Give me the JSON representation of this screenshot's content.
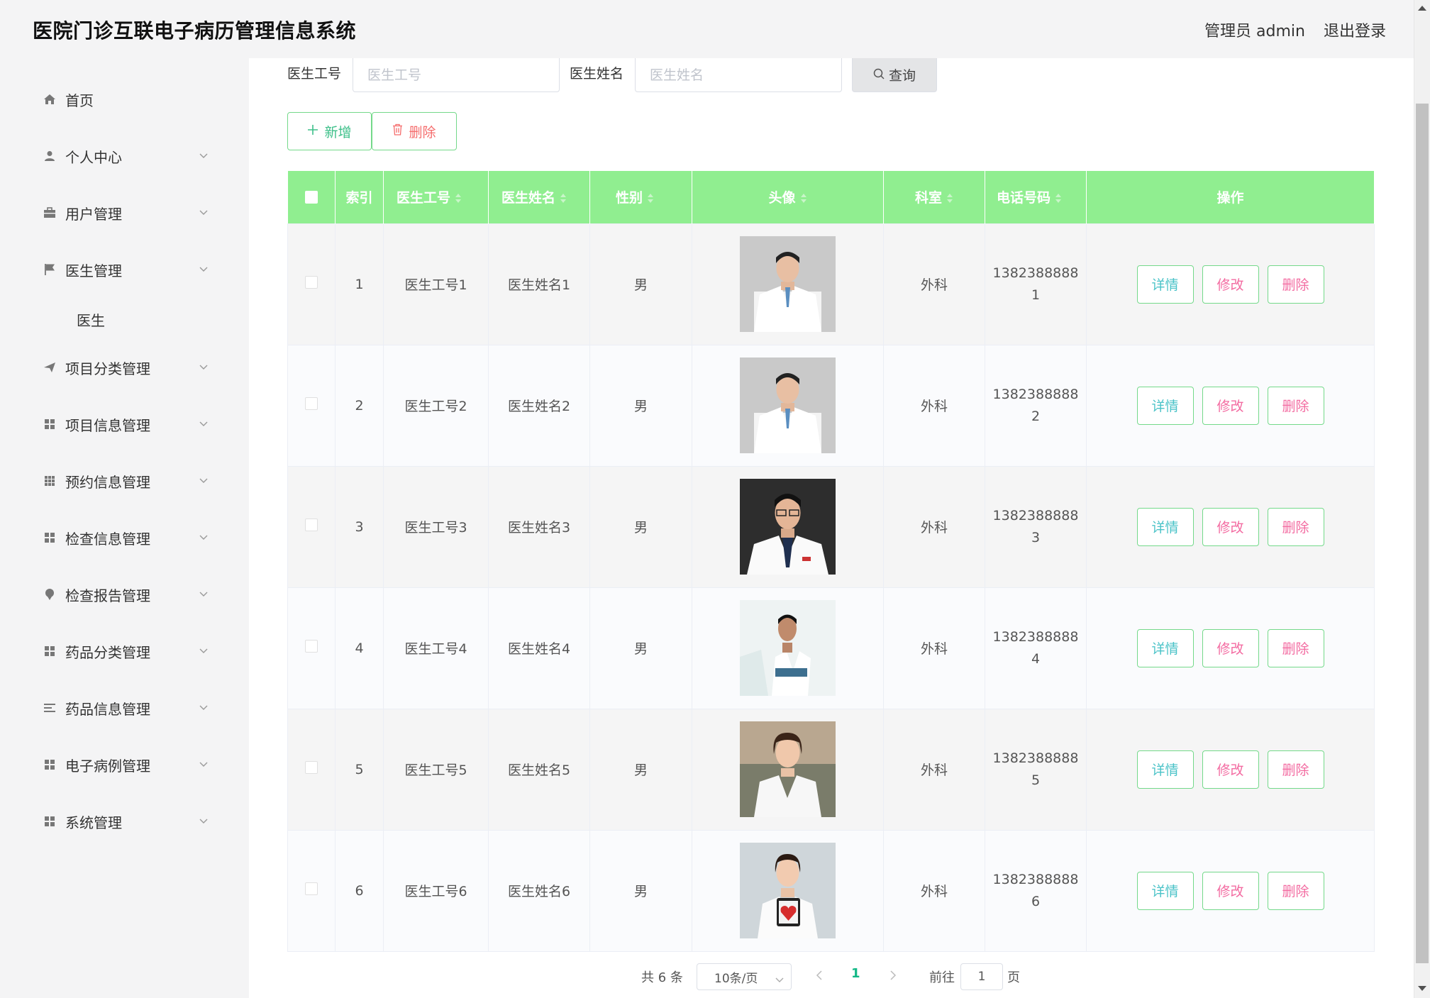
{
  "header": {
    "title": "医院门诊互联电子病历管理信息系统",
    "user": "管理员 admin",
    "logout": "退出登录"
  },
  "sidebar": {
    "items": [
      {
        "label": "首页",
        "icon": "home-icon"
      },
      {
        "label": "个人中心",
        "icon": "user-icon"
      },
      {
        "label": "用户管理",
        "icon": "briefcase-icon"
      },
      {
        "label": "医生管理",
        "icon": "flag-icon"
      },
      {
        "label": "项目分类管理",
        "icon": "send-icon"
      },
      {
        "label": "项目信息管理",
        "icon": "grid-icon"
      },
      {
        "label": "预约信息管理",
        "icon": "apps-icon"
      },
      {
        "label": "检查信息管理",
        "icon": "grid-icon"
      },
      {
        "label": "检查报告管理",
        "icon": "pin-icon"
      },
      {
        "label": "药品分类管理",
        "icon": "grid-icon"
      },
      {
        "label": "药品信息管理",
        "icon": "list-icon"
      },
      {
        "label": "电子病例管理",
        "icon": "grid-icon"
      },
      {
        "label": "系统管理",
        "icon": "grid-icon"
      }
    ],
    "sub_doctor": "医生"
  },
  "search": {
    "id_label": "医生工号",
    "id_placeholder": "医生工号",
    "name_label": "医生姓名",
    "name_placeholder": "医生姓名",
    "query_label": "查询"
  },
  "toolbar": {
    "add_label": "新增",
    "delete_label": "删除"
  },
  "table": {
    "headers": {
      "index": "索引",
      "doctor_id": "医生工号",
      "doctor_name": "医生姓名",
      "gender": "性别",
      "avatar": "头像",
      "department": "科室",
      "phone": "电话号码",
      "actions": "操作"
    },
    "rows": [
      {
        "index": "1",
        "doctor_id": "医生工号1",
        "doctor_name": "医生姓名1",
        "gender": "男",
        "department": "外科",
        "phone_main": "1382388888",
        "phone_tail": "1"
      },
      {
        "index": "2",
        "doctor_id": "医生工号2",
        "doctor_name": "医生姓名2",
        "gender": "男",
        "department": "外科",
        "phone_main": "1382388888",
        "phone_tail": "2"
      },
      {
        "index": "3",
        "doctor_id": "医生工号3",
        "doctor_name": "医生姓名3",
        "gender": "男",
        "department": "外科",
        "phone_main": "1382388888",
        "phone_tail": "3"
      },
      {
        "index": "4",
        "doctor_id": "医生工号4",
        "doctor_name": "医生姓名4",
        "gender": "男",
        "department": "外科",
        "phone_main": "1382388888",
        "phone_tail": "4"
      },
      {
        "index": "5",
        "doctor_id": "医生工号5",
        "doctor_name": "医生姓名5",
        "gender": "男",
        "department": "外科",
        "phone_main": "1382388888",
        "phone_tail": "5"
      },
      {
        "index": "6",
        "doctor_id": "医生工号6",
        "doctor_name": "医生姓名6",
        "gender": "男",
        "department": "外科",
        "phone_main": "1382388888",
        "phone_tail": "6"
      }
    ],
    "action_labels": {
      "detail": "详情",
      "edit": "修改",
      "remove": "删除"
    }
  },
  "pagination": {
    "total": "共 6 条",
    "page_size": "10条/页",
    "current_page": "1",
    "goto_label": "前往",
    "goto_value": "1",
    "page_unit": "页"
  },
  "colors": {
    "table_header_bg": "#90ee90",
    "accent_green": "#12b886",
    "delete_red": "#f56c6c",
    "edit_pink": "#f36ba1",
    "detail_teal": "#4bc3c8"
  }
}
